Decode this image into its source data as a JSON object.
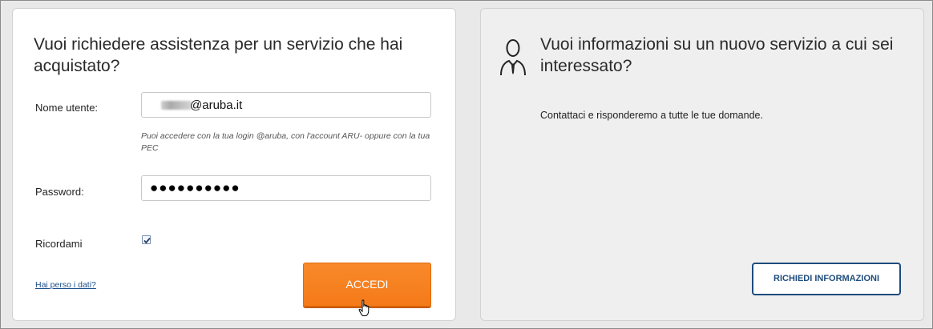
{
  "login_panel": {
    "title": "Vuoi richiedere assistenza per un servizio che hai acquistato?",
    "username_label": "Nome utente:",
    "username_value": "@aruba.it",
    "hint": "Puoi accedere con la tua login @aruba, con l'account ARU- oppure con la tua PEC",
    "password_label": "Password:",
    "password_value": "●●●●●●●●●●",
    "remember_label": "Ricordami",
    "remember_checked": true,
    "forgot_link": "Hai perso i dati?",
    "submit_label": "ACCEDI"
  },
  "info_panel": {
    "icon": "person-tie-icon",
    "title": "Vuoi informazioni su un nuovo servizio a cui sei interessato?",
    "text": "Contattaci e risponderemo a tutte le tue domande.",
    "button_label": "RICHIEDI INFORMAZIONI"
  },
  "colors": {
    "accent_orange": "#f57a18",
    "button_blue": "#1f4c7d",
    "link_blue": "#1c4f8c"
  }
}
